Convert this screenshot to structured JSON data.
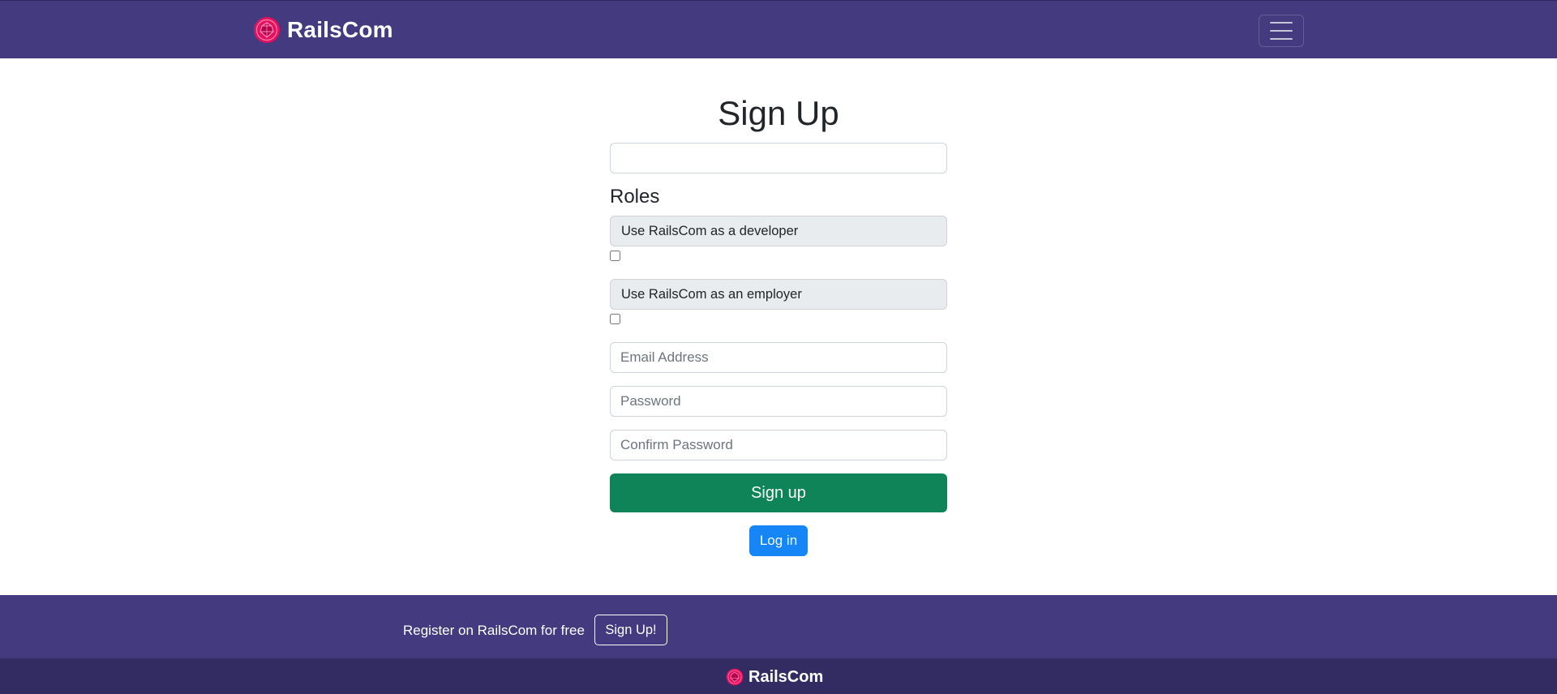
{
  "navbar": {
    "brand": "RailsCom",
    "logo_icon": "ruby-gem-icon",
    "menu_icon": "hamburger-menu-icon",
    "logo_color": "#e0115f"
  },
  "form": {
    "title": "Sign Up",
    "name_value": "",
    "roles_heading": "Roles",
    "role_developer": "Use RailsCom as a developer",
    "role_employer": "Use RailsCom as an employer",
    "email_placeholder": "Email Address",
    "password_placeholder": "Password",
    "confirm_placeholder": "Confirm Password",
    "signup_label": "Sign up",
    "login_label": "Log in"
  },
  "footer": {
    "register_text": "Register on RailsCom for free",
    "signup_button": "Sign Up!",
    "brand": "RailsCom"
  },
  "colors": {
    "nav_bg": "#433a7f",
    "footer_bottom_bg": "#332c63",
    "signup_btn": "#0f8458",
    "login_btn": "#1685f5"
  }
}
